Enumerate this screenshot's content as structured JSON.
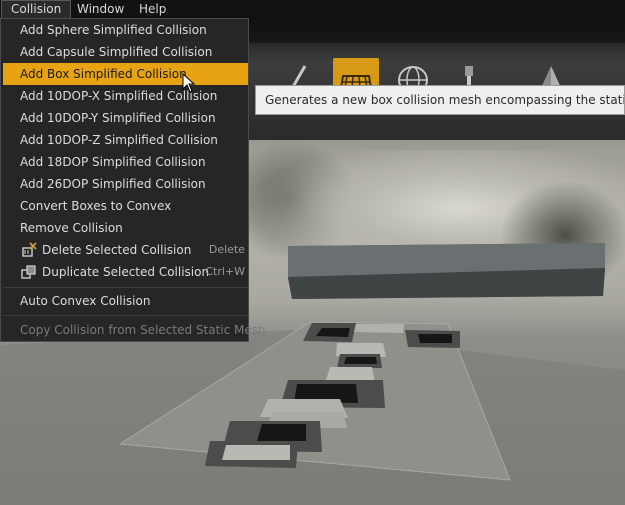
{
  "menubar": {
    "items": [
      {
        "label": "Collision",
        "open": true
      },
      {
        "label": "Window"
      },
      {
        "label": "Help"
      }
    ]
  },
  "collision_menu": {
    "items": [
      {
        "label": "Add Sphere Simplified Collision"
      },
      {
        "label": "Add Capsule Simplified Collision"
      },
      {
        "label": "Add Box Simplified Collision",
        "highlighted": true
      },
      {
        "label": "Add 10DOP-X Simplified Collision"
      },
      {
        "label": "Add 10DOP-Y Simplified Collision"
      },
      {
        "label": "Add 10DOP-Z Simplified Collision"
      },
      {
        "label": "Add 18DOP Simplified Collision"
      },
      {
        "label": "Add 26DOP Simplified Collision"
      },
      {
        "label": "Convert Boxes to Convex"
      },
      {
        "label": "Remove Collision"
      },
      {
        "label": "Delete Selected Collision",
        "shortcut": "Delete",
        "icon": "delete-collision-icon"
      },
      {
        "label": "Duplicate Selected Collision",
        "shortcut": "Ctrl+W",
        "icon": "duplicate-collision-icon"
      },
      {
        "label": "Auto Convex Collision"
      },
      {
        "label": "Copy Collision from Selected Static Mesh",
        "disabled": true
      }
    ]
  },
  "tooltip": {
    "text": "Generates a new box collision mesh encompassing the static"
  },
  "toolbar": {
    "tools": [
      {
        "icon": "brush-icon"
      },
      {
        "icon": "box-collision-icon",
        "active": true
      },
      {
        "icon": "sphere-cage-icon"
      },
      {
        "icon": "pin-icon"
      },
      {
        "icon": "pyramid-icon"
      }
    ]
  },
  "colors": {
    "highlight": "#e8a312",
    "menu_bg": "#262626",
    "tooltip_bg": "#efefef",
    "active_tool": "#d79a14"
  }
}
